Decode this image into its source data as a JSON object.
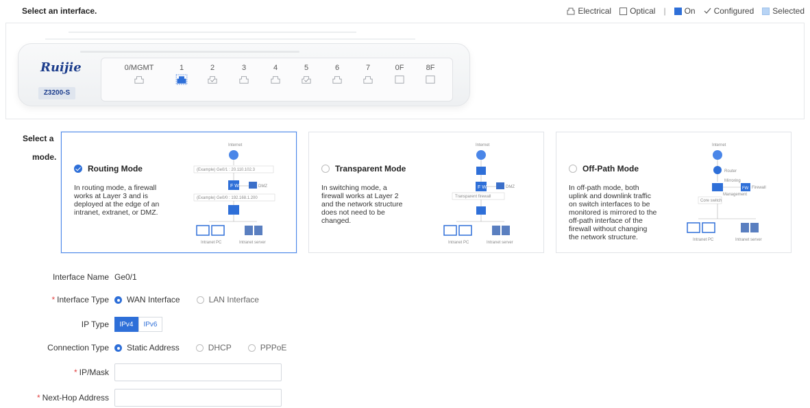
{
  "header": {
    "title": "Select an interface."
  },
  "legend": {
    "electrical": "Electrical",
    "optical": "Optical",
    "separator": "|",
    "on": "On",
    "configured": "Configured",
    "selected": "Selected"
  },
  "device": {
    "brand": "Ruijie",
    "model": "Z3200-S",
    "ports": [
      {
        "label": "0/MGMT",
        "kind": "electrical",
        "state": "normal"
      },
      {
        "label": "1",
        "kind": "electrical",
        "state": "selected"
      },
      {
        "label": "2",
        "kind": "electrical",
        "state": "configured"
      },
      {
        "label": "3",
        "kind": "electrical",
        "state": "normal"
      },
      {
        "label": "4",
        "kind": "electrical",
        "state": "normal"
      },
      {
        "label": "5",
        "kind": "electrical",
        "state": "configured"
      },
      {
        "label": "6",
        "kind": "electrical",
        "state": "normal"
      },
      {
        "label": "7",
        "kind": "electrical",
        "state": "normal"
      },
      {
        "label": "0F",
        "kind": "optical",
        "state": "normal"
      },
      {
        "label": "8F",
        "kind": "optical",
        "state": "normal"
      }
    ]
  },
  "mode_section": {
    "label_line1": "Select a",
    "label_line2": "mode."
  },
  "modes": [
    {
      "title": "Routing Mode",
      "selected": true,
      "description": "In routing mode, a firewall works at Layer 3 and is deployed at the edge of an intranet, extranet, or DMZ.",
      "diagram": {
        "internet": "Internet",
        "ex1": "(Example) Ge0/1 : 20.110.102.3",
        "dmz": "DMZ",
        "ex2": "(Example) Ge0/0 : 192.168.1.200",
        "pc": "Intranet PC",
        "server": "Intranet server"
      }
    },
    {
      "title": "Transparent Mode",
      "selected": false,
      "description": "In switching mode, a firewall works at Layer 2 and the network structure does not need to be changed.",
      "diagram": {
        "internet": "Internet",
        "dmz": "DMZ",
        "fw": "Transparent firewall",
        "pc": "Intranet PC",
        "server": "Intranet server"
      }
    },
    {
      "title": "Off-Path Mode",
      "selected": false,
      "description": "In off-path mode, both uplink and downlink traffic on switch interfaces to be monitored is mirrored to the off-path interface of the firewall without changing the network structure.",
      "diagram": {
        "internet": "Internet",
        "router": "Router",
        "mirroring": "Mirroring",
        "firewall": "Firewall",
        "management": "Management",
        "core": "Core switch",
        "pc": "Intranet PC",
        "server": "Intranet server"
      }
    }
  ],
  "form": {
    "interface_name": {
      "label": "Interface Name",
      "value": "Ge0/1"
    },
    "interface_type": {
      "label": "Interface Type",
      "options": [
        "WAN Interface",
        "LAN Interface"
      ],
      "selected": "WAN Interface"
    },
    "ip_type": {
      "label": "IP Type",
      "options": [
        "IPv4",
        "IPv6"
      ],
      "selected": "IPv4"
    },
    "connection_type": {
      "label": "Connection Type",
      "options": [
        "Static Address",
        "DHCP",
        "PPPoE"
      ],
      "selected": "Static Address"
    },
    "ip_mask": {
      "label": "IP/Mask",
      "value": "",
      "placeholder": ""
    },
    "next_hop": {
      "label": "Next-Hop Address",
      "value": "",
      "placeholder": ""
    }
  },
  "colors": {
    "accent": "#2e6fd8",
    "selected_fill": "#b8d4f5",
    "required": "#e04040",
    "brand": "#1b3c8c"
  }
}
